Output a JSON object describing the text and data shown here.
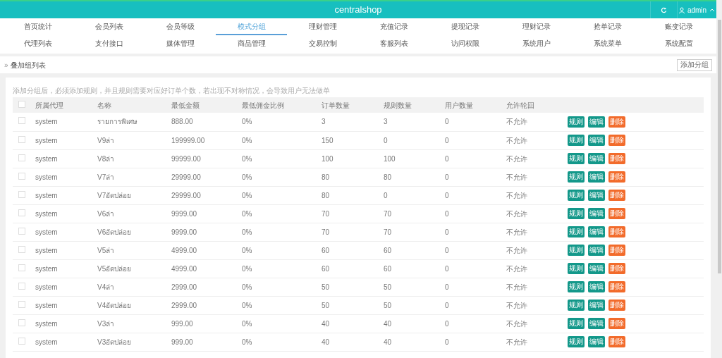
{
  "header": {
    "title": "centralshop",
    "user": "admin"
  },
  "nav": [
    {
      "label": "首页统计",
      "selected": false
    },
    {
      "label": "会员列表",
      "selected": false
    },
    {
      "label": "会员等级",
      "selected": false
    },
    {
      "label": "模式分组",
      "selected": true
    },
    {
      "label": "理财管理",
      "selected": false
    },
    {
      "label": "充值记录",
      "selected": false
    },
    {
      "label": "提现记录",
      "selected": false
    },
    {
      "label": "理财记录",
      "selected": false
    },
    {
      "label": "抢单记录",
      "selected": false
    },
    {
      "label": "账变记录",
      "selected": false
    },
    {
      "label": "代理列表",
      "selected": false
    },
    {
      "label": "支付接口",
      "selected": false
    },
    {
      "label": "媒体管理",
      "selected": false
    },
    {
      "label": "商品管理",
      "selected": false
    },
    {
      "label": "交易控制",
      "selected": false
    },
    {
      "label": "客服列表",
      "selected": false
    },
    {
      "label": "访问权限",
      "selected": false
    },
    {
      "label": "系统用户",
      "selected": false
    },
    {
      "label": "系统菜单",
      "selected": false
    },
    {
      "label": "系统配置",
      "selected": false
    }
  ],
  "breadcrumb": {
    "marker": "»",
    "title": "叠加组列表",
    "button": "添加分组"
  },
  "notice": "添加分组后，必须添加规则，并且规则需要对应好订单个数，若出现不对称情况，会导致用户无法做单",
  "table": {
    "header_checked": false,
    "columns": [
      "所属代理",
      "名称",
      "最低金额",
      "最低佣金比例",
      "订单数量",
      "规则数量",
      "用户数量",
      "允许轮回"
    ],
    "rows": [
      {
        "checked": false,
        "cells": [
          "system",
          "รายการพิเศษ",
          "888.00",
          "0%",
          "3",
          "3",
          "0",
          "不允许"
        ],
        "actions": [
          {
            "label": "规则",
            "kind": "primary"
          },
          {
            "label": "编辑",
            "kind": "primary"
          },
          {
            "label": "删除",
            "kind": "danger"
          }
        ]
      },
      {
        "checked": false,
        "cells": [
          "system",
          "V9ล่า",
          "199999.00",
          "0%",
          "150",
          "0",
          "0",
          "不允许"
        ],
        "actions": [
          {
            "label": "规则",
            "kind": "primary"
          },
          {
            "label": "编辑",
            "kind": "primary"
          },
          {
            "label": "删除",
            "kind": "danger"
          }
        ]
      },
      {
        "checked": false,
        "cells": [
          "system",
          "V8ล่า",
          "99999.00",
          "0%",
          "100",
          "100",
          "0",
          "不允许"
        ],
        "actions": [
          {
            "label": "规则",
            "kind": "primary"
          },
          {
            "label": "编辑",
            "kind": "primary"
          },
          {
            "label": "删除",
            "kind": "danger"
          }
        ]
      },
      {
        "checked": false,
        "cells": [
          "system",
          "V7ล่า",
          "29999.00",
          "0%",
          "80",
          "80",
          "0",
          "不允许"
        ],
        "actions": [
          {
            "label": "规则",
            "kind": "primary"
          },
          {
            "label": "编辑",
            "kind": "primary"
          },
          {
            "label": "删除",
            "kind": "danger"
          }
        ]
      },
      {
        "checked": false,
        "cells": [
          "system",
          "V7อัดปล่อย",
          "29999.00",
          "0%",
          "80",
          "0",
          "0",
          "不允许"
        ],
        "actions": [
          {
            "label": "规则",
            "kind": "primary"
          },
          {
            "label": "编辑",
            "kind": "primary"
          },
          {
            "label": "删除",
            "kind": "danger"
          }
        ]
      },
      {
        "checked": false,
        "cells": [
          "system",
          "V6ล่า",
          "9999.00",
          "0%",
          "70",
          "70",
          "0",
          "不允许"
        ],
        "actions": [
          {
            "label": "规则",
            "kind": "primary"
          },
          {
            "label": "编辑",
            "kind": "primary"
          },
          {
            "label": "删除",
            "kind": "danger"
          }
        ]
      },
      {
        "checked": false,
        "cells": [
          "system",
          "V6อัดปล่อย",
          "9999.00",
          "0%",
          "70",
          "70",
          "0",
          "不允许"
        ],
        "actions": [
          {
            "label": "规则",
            "kind": "primary"
          },
          {
            "label": "编辑",
            "kind": "primary"
          },
          {
            "label": "删除",
            "kind": "danger"
          }
        ]
      },
      {
        "checked": false,
        "cells": [
          "system",
          "V5ล่า",
          "4999.00",
          "0%",
          "60",
          "60",
          "0",
          "不允许"
        ],
        "actions": [
          {
            "label": "规则",
            "kind": "primary"
          },
          {
            "label": "编辑",
            "kind": "primary"
          },
          {
            "label": "删除",
            "kind": "danger"
          }
        ]
      },
      {
        "checked": false,
        "cells": [
          "system",
          "V5อัดปล่อย",
          "4999.00",
          "0%",
          "60",
          "60",
          "0",
          "不允许"
        ],
        "actions": [
          {
            "label": "规则",
            "kind": "primary"
          },
          {
            "label": "编辑",
            "kind": "primary"
          },
          {
            "label": "删除",
            "kind": "danger"
          }
        ]
      },
      {
        "checked": false,
        "cells": [
          "system",
          "V4ล่า",
          "2999.00",
          "0%",
          "50",
          "50",
          "0",
          "不允许"
        ],
        "actions": [
          {
            "label": "规则",
            "kind": "primary"
          },
          {
            "label": "编辑",
            "kind": "primary"
          },
          {
            "label": "删除",
            "kind": "danger"
          }
        ]
      },
      {
        "checked": false,
        "cells": [
          "system",
          "V4อัดปล่อย",
          "2999.00",
          "0%",
          "50",
          "50",
          "0",
          "不允许"
        ],
        "actions": [
          {
            "label": "规则",
            "kind": "primary"
          },
          {
            "label": "编辑",
            "kind": "primary"
          },
          {
            "label": "删除",
            "kind": "danger"
          }
        ]
      },
      {
        "checked": false,
        "cells": [
          "system",
          "V3ล่า",
          "999.00",
          "0%",
          "40",
          "40",
          "0",
          "不允许"
        ],
        "actions": [
          {
            "label": "规则",
            "kind": "primary"
          },
          {
            "label": "编辑",
            "kind": "primary"
          },
          {
            "label": "删除",
            "kind": "danger"
          }
        ]
      },
      {
        "checked": false,
        "cells": [
          "system",
          "V3อัดปล่อย",
          "999.00",
          "0%",
          "40",
          "40",
          "0",
          "不允许"
        ],
        "actions": [
          {
            "label": "规则",
            "kind": "primary"
          },
          {
            "label": "编辑",
            "kind": "primary"
          },
          {
            "label": "删除",
            "kind": "danger"
          }
        ]
      }
    ]
  }
}
